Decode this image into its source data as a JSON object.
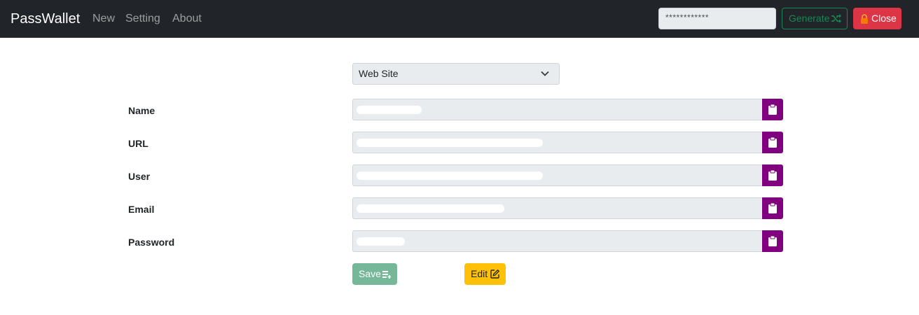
{
  "navbar": {
    "brand": "PassWallet",
    "links": [
      "New",
      "Setting",
      "About"
    ],
    "generated_password": "************",
    "generate_label": "Generate",
    "close_label": "Close"
  },
  "form": {
    "type_select": "Web Site",
    "fields": [
      {
        "label": "Name"
      },
      {
        "label": "URL"
      },
      {
        "label": "User"
      },
      {
        "label": "Email"
      },
      {
        "label": "Password"
      }
    ],
    "save_label": "Save",
    "edit_label": "Edit"
  },
  "icons": {
    "generate": "shuffle-icon",
    "close": "lock-icon",
    "copy": "clipboard-icon",
    "select": "chevron-down-icon",
    "save": "save-icon",
    "edit": "edit-icon"
  },
  "colors": {
    "navbar": "#212529",
    "generate": "#198754",
    "close": "#dc3545",
    "copy": "#800080",
    "save": "#75b798",
    "edit": "#ffc107"
  }
}
